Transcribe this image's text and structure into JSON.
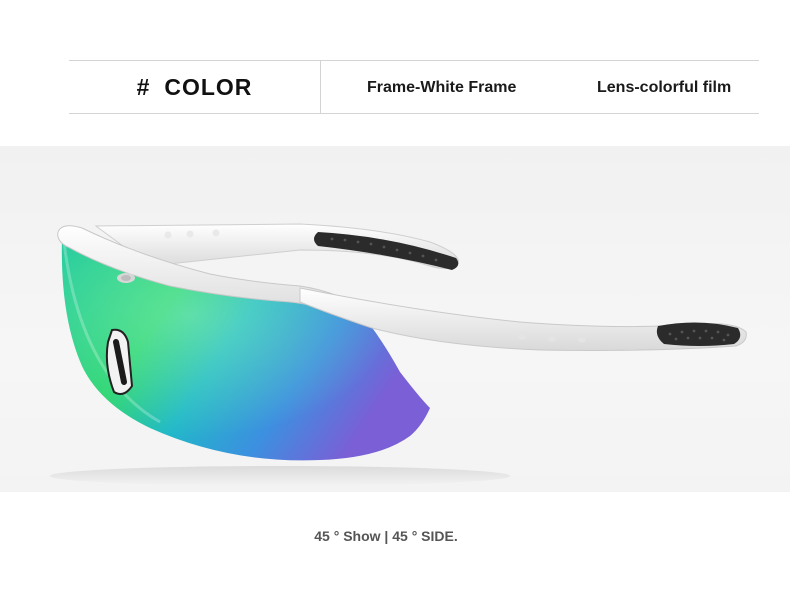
{
  "header": {
    "hash": "#",
    "title": "COLOR",
    "frame": "Frame-White Frame",
    "lens": "Lens-colorful film"
  },
  "product_image": {
    "subject": "sunglasses-icon",
    "frame_color": "#ffffff",
    "lens_colors": [
      "#2fd27a",
      "#17a7c9",
      "#7a5fd6"
    ]
  },
  "caption": "45 ° Show | 45 ° SIDE."
}
